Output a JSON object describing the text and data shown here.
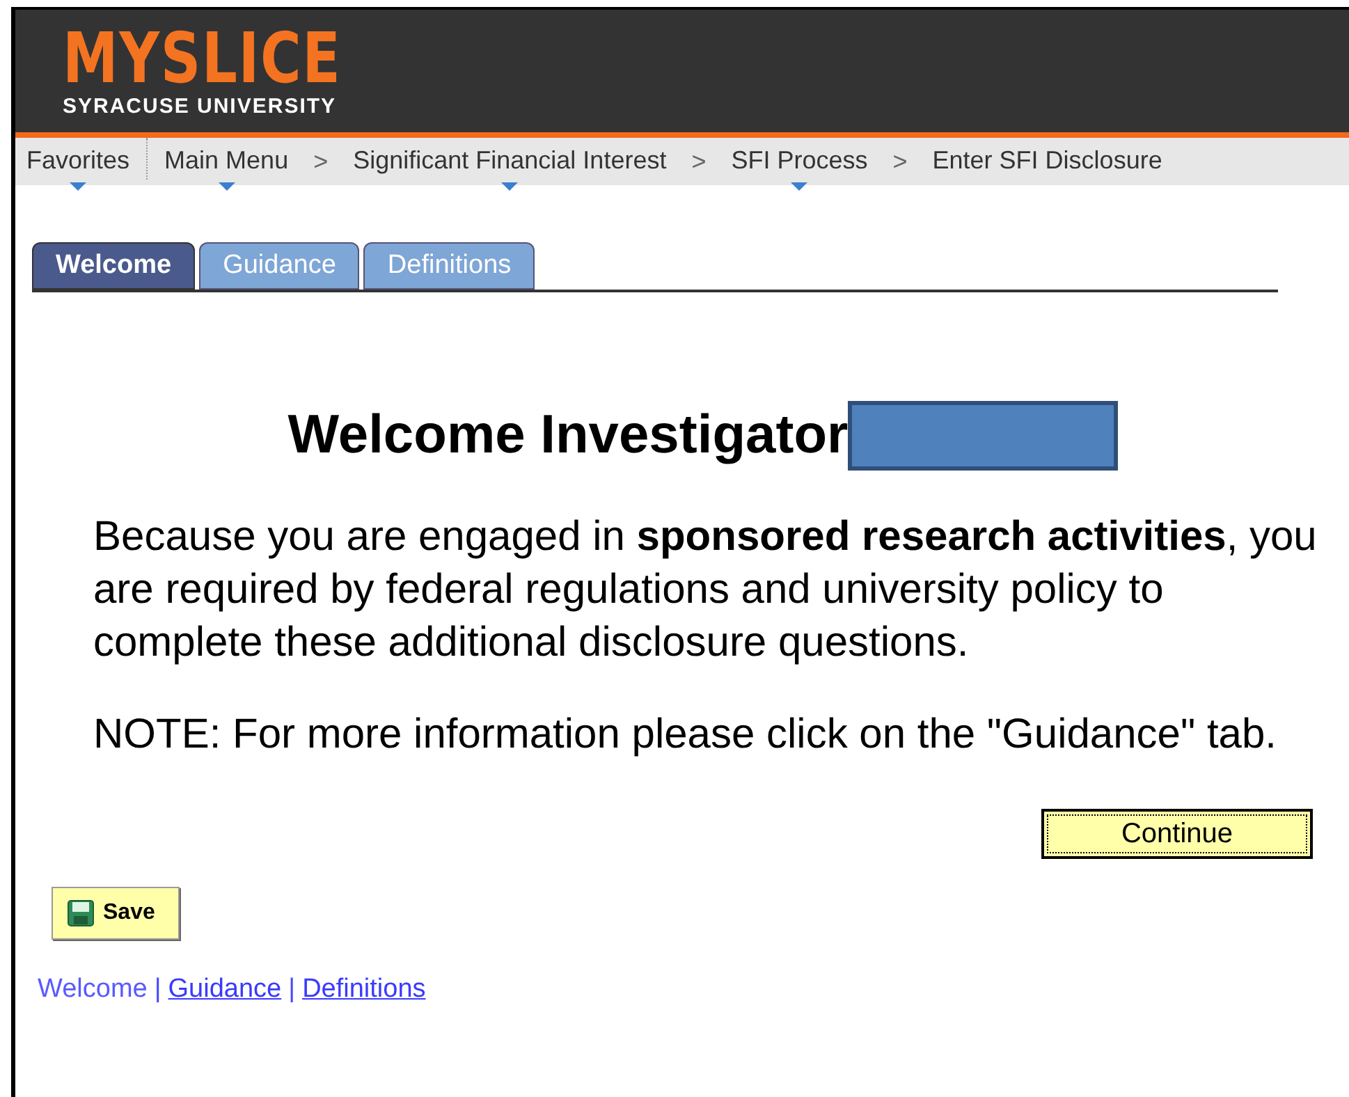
{
  "header": {
    "logo": "MYSLICE",
    "subtitle": "SYRACUSE UNIVERSITY"
  },
  "nav": [
    {
      "label": "Favorites",
      "has_menu": true
    },
    {
      "label": "Main Menu",
      "has_menu": true
    },
    {
      "label": "Significant Financial Interest",
      "has_menu": true,
      "separator": ">"
    },
    {
      "label": "SFI Process",
      "has_menu": true,
      "separator": ">"
    },
    {
      "label": "Enter SFI Disclosure",
      "has_menu": false,
      "separator": ">"
    }
  ],
  "tabs": [
    {
      "label": "Welcome",
      "selected": true
    },
    {
      "label": "Guidance",
      "selected": false
    },
    {
      "label": "Definitions",
      "selected": false
    }
  ],
  "heading": {
    "text": "Welcome Investigator",
    "redacted": true
  },
  "paragraphs": [
    "Because you are engaged in **sponsored research activities**, you are required by federal regulations and university policy to complete these additional disclosure questions.",
    "NOTE: For more information please click on the \"Guidance\" tab."
  ],
  "continue_button": "Continue",
  "save_button": "Save",
  "bottom_links": [
    {
      "label": "Welcome",
      "selected": true
    },
    {
      "label": "Guidance",
      "selected": false,
      "separator": "|"
    },
    {
      "label": "Definitions",
      "selected": false,
      "separator": "|"
    }
  ]
}
